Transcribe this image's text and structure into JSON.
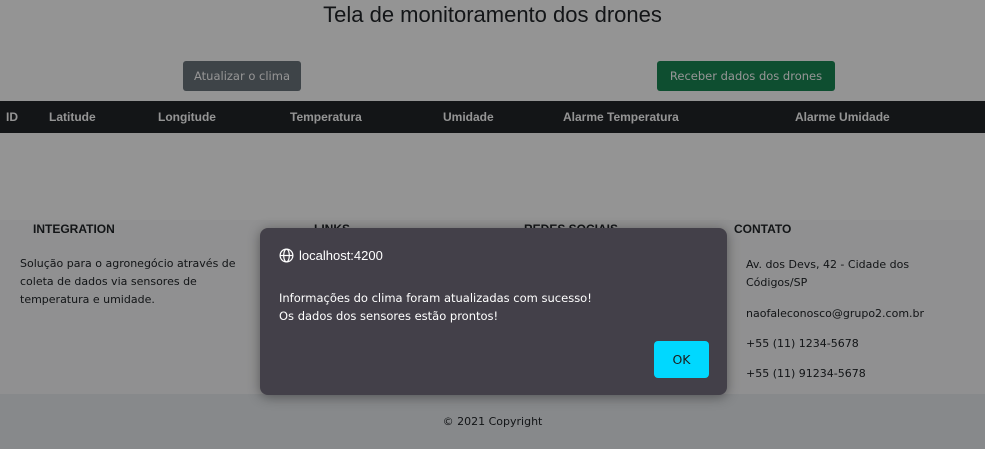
{
  "page": {
    "title": "Tela de monitoramento dos drones"
  },
  "toolbar": {
    "update_weather_label": "Atualizar o clima",
    "receive_data_label": "Receber dados dos drones"
  },
  "table": {
    "columns": [
      "ID",
      "Latitude",
      "Longitude",
      "Temperatura",
      "Umidade",
      "Alarme Temperatura",
      "Alarme Umidade"
    ],
    "rows": []
  },
  "footer": {
    "integration": {
      "title": "INTEGRATION",
      "text": "Solução para o agronegócio através de coleta de dados via sensores de temperatura e umidade."
    },
    "links": {
      "title": "LINKS"
    },
    "social": {
      "title": "REDES SOCIAIS"
    },
    "contact": {
      "title": "CONTATO",
      "address": "Av. dos Devs, 42 - Cidade dos Códigos/SP",
      "email": "naofaleconosco@grupo2.com.br",
      "phone1": "+55 (11) 1234-5678",
      "phone2": "+55 (11) 91234-5678"
    },
    "copyright": "© 2021 Copyright"
  },
  "dialog": {
    "origin": "localhost:4200",
    "message_line1": "Informações do clima foram atualizadas com sucesso!",
    "message_line2": "Os dados dos sensores estão prontos!",
    "ok_label": "OK"
  },
  "colors": {
    "update_button": "#6c757d",
    "receive_button": "#198754",
    "table_header": "#212529",
    "dialog_bg": "#434049",
    "ok_button": "#00d8ff"
  },
  "icons": {
    "dialog_origin": "globe-icon"
  }
}
